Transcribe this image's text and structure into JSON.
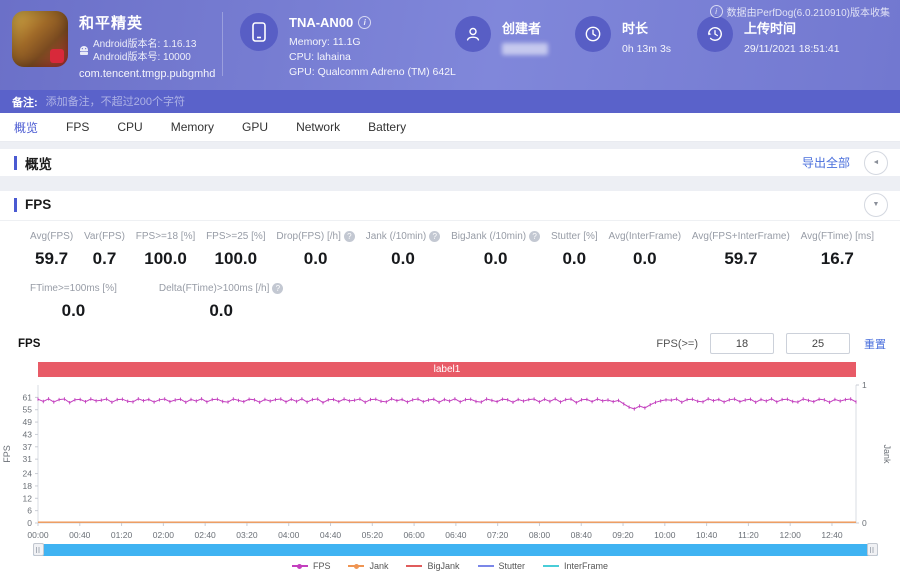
{
  "header": {
    "app": {
      "title": "和平精英",
      "version_name": "Android版本名: 1.16.13",
      "version_code": "Android版本号: 10000",
      "package": "com.tencent.tmgp.pubgmhd"
    },
    "device": {
      "name": "TNA-AN00",
      "memory": "Memory: 11.1G",
      "cpu": "CPU: lahaina",
      "gpu": "GPU: Qualcomm Adreno (TM) 642L"
    },
    "creator": {
      "label": "创建者"
    },
    "duration": {
      "label": "时长",
      "value": "0h 13m 3s"
    },
    "upload": {
      "label": "上传时间",
      "value": "29/11/2021 18:51:41"
    },
    "collected_note": "数据由PerfDog(6.0.210910)版本收集"
  },
  "remark": {
    "label": "备注:",
    "placeholder": "添加备注，不超过200个字符"
  },
  "tabs": [
    {
      "label": "概览",
      "active": true
    },
    {
      "label": "FPS",
      "active": false
    },
    {
      "label": "CPU",
      "active": false
    },
    {
      "label": "Memory",
      "active": false
    },
    {
      "label": "GPU",
      "active": false
    },
    {
      "label": "Network",
      "active": false
    },
    {
      "label": "Battery",
      "active": false
    }
  ],
  "overview": {
    "title": "概览",
    "export_label": "导出全部"
  },
  "fps_section": {
    "title": "FPS",
    "chart_title": "FPS",
    "band_label": "label1",
    "threshold": {
      "label": "FPS(>=)",
      "input1": "18",
      "input2": "25",
      "reset_label": "重置"
    },
    "stats_row1": [
      {
        "label": "Avg(FPS)",
        "value": "59.7",
        "help": false
      },
      {
        "label": "Var(FPS)",
        "value": "0.7",
        "help": false
      },
      {
        "label": "FPS>=18 [%]",
        "value": "100.0",
        "help": false
      },
      {
        "label": "FPS>=25 [%]",
        "value": "100.0",
        "help": false
      },
      {
        "label": "Drop(FPS) [/h]",
        "value": "0.0",
        "help": true
      },
      {
        "label": "Jank (/10min)",
        "value": "0.0",
        "help": true
      },
      {
        "label": "BigJank (/10min)",
        "value": "0.0",
        "help": true
      },
      {
        "label": "Stutter [%]",
        "value": "0.0",
        "help": false
      },
      {
        "label": "Avg(InterFrame)",
        "value": "0.0",
        "help": false
      },
      {
        "label": "Avg(FPS+InterFrame)",
        "value": "59.7",
        "help": false
      },
      {
        "label": "Avg(FTime) [ms]",
        "value": "16.7",
        "help": false
      }
    ],
    "stats_row2": [
      {
        "label": "FTime>=100ms [%]",
        "value": "0.0",
        "help": false
      },
      {
        "label": "Delta(FTime)>100ms [/h]",
        "value": "0.0",
        "help": true
      }
    ]
  },
  "chart_data": {
    "type": "line",
    "title": "FPS",
    "x_tick_labels": [
      "00:00",
      "00:40",
      "01:20",
      "02:00",
      "02:40",
      "03:20",
      "04:00",
      "04:40",
      "05:20",
      "06:00",
      "06:40",
      "07:20",
      "08:00",
      "08:40",
      "09:20",
      "10:00",
      "10:40",
      "11:20",
      "12:00",
      "12:40"
    ],
    "x_total_seconds": 783,
    "x_tick_interval_seconds": 40,
    "y_left": {
      "label": "FPS",
      "ticks": [
        61,
        55,
        49,
        43,
        37,
        31,
        24,
        18,
        12,
        6,
        0
      ],
      "max": 67
    },
    "y_right": {
      "label": "Jank",
      "ticks": [
        1,
        0
      ]
    },
    "series": [
      {
        "name": "FPS",
        "color": "#c33fbe",
        "values": [
          60.1,
          59.0,
          60.3,
          58.7,
          59.9,
          60.2,
          58.4,
          59.8,
          60.0,
          58.9,
          60.2,
          59.3,
          59.6,
          60.2,
          58.6,
          59.9,
          60.1,
          59.1,
          58.8,
          60.3,
          59.4,
          60.0,
          58.7,
          59.8,
          60.2,
          58.9,
          59.7,
          60.1,
          58.6,
          60.0,
          59.2,
          60.3,
          58.8,
          59.9,
          60.1,
          59.0,
          58.7,
          60.2,
          59.5,
          58.9,
          60.1,
          59.8,
          58.6,
          60.0,
          59.2,
          59.9,
          60.2,
          58.8,
          60.1,
          59.0,
          60.3,
          58.7,
          59.9,
          60.2,
          58.4,
          59.8,
          60.0,
          58.9,
          60.2,
          59.3,
          59.6,
          60.2,
          58.6,
          59.9,
          60.1,
          59.1,
          58.8,
          60.3,
          59.4,
          60.0,
          58.7,
          59.8,
          60.2,
          58.9,
          59.7,
          60.1,
          58.6,
          60.0,
          59.2,
          60.3,
          58.8,
          59.9,
          60.1,
          59.0,
          58.7,
          60.2,
          59.5,
          58.9,
          60.1,
          59.8,
          58.6,
          60.0,
          59.2,
          59.9,
          60.2,
          58.8,
          60.1,
          59.0,
          60.3,
          58.7,
          59.9,
          60.2,
          58.4,
          59.8,
          60.0,
          58.9,
          60.2,
          59.3,
          59.7,
          58.9,
          59.5,
          57.8,
          56.2,
          55.4,
          56.8,
          55.9,
          57.4,
          58.6,
          59.3,
          59.8,
          59.6,
          60.2,
          58.6,
          59.9,
          60.1,
          59.1,
          58.8,
          60.3,
          59.4,
          60.0,
          58.7,
          59.8,
          60.2,
          58.9,
          59.7,
          60.1,
          58.6,
          60.0,
          59.2,
          60.3,
          58.8,
          59.9,
          60.1,
          59.0,
          58.7,
          60.2,
          59.5,
          58.9,
          60.1,
          59.8,
          58.6,
          60.0,
          59.2,
          59.9,
          60.2,
          58.8
        ]
      },
      {
        "name": "Jank",
        "color": "#ef9553",
        "constant": 0
      }
    ]
  },
  "legend": [
    {
      "name": "FPS",
      "color": "#c33fbe",
      "marker": true
    },
    {
      "name": "Jank",
      "color": "#ef9553",
      "marker": true
    },
    {
      "name": "BigJank",
      "color": "#e05c5c",
      "marker": false
    },
    {
      "name": "Stutter",
      "color": "#7b87e8",
      "marker": false
    },
    {
      "name": "InterFrame",
      "color": "#49cdd8",
      "marker": false
    }
  ]
}
